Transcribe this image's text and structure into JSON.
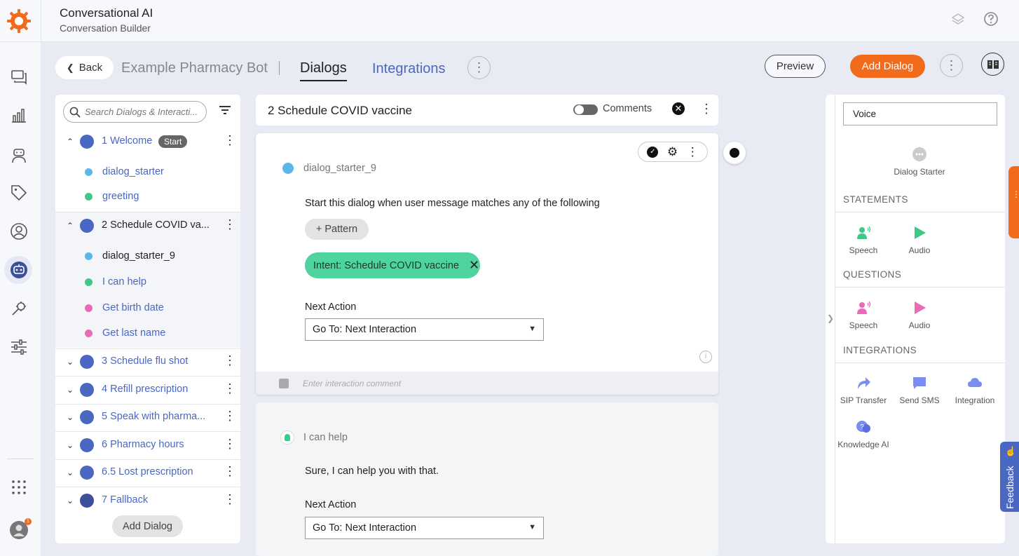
{
  "header": {
    "app_title": "Conversational AI",
    "app_subtitle": "Conversation Builder",
    "icons": [
      "logo-icon",
      "layers-icon",
      "help-icon"
    ]
  },
  "rail": {
    "icons": [
      "messages-icon",
      "analytics-icon",
      "agent-icon",
      "tag-icon",
      "user-icon",
      "bot-icon",
      "automation-icon",
      "settings-sliders-icon",
      "apps-grid-icon",
      "profile-avatar-icon"
    ],
    "active": "bot-icon",
    "notification_badge": "1"
  },
  "page_header": {
    "back_label": "Back",
    "bot_name": "Example Pharmacy Bot",
    "tabs": [
      {
        "label": "Dialogs",
        "active": true
      },
      {
        "label": "Integrations",
        "active": false
      }
    ],
    "preview_label": "Preview",
    "add_dialog_label": "Add Dialog"
  },
  "dialog_list": {
    "search_placeholder": "Search Dialogs & Interacti...",
    "start_badge": "Start",
    "dialogs": [
      {
        "label": "1 Welcome",
        "expanded": true
      },
      {
        "label": "2 Schedule COVID va...",
        "expanded": true,
        "selected": true
      },
      {
        "label": "3 Schedule flu shot",
        "expanded": false
      },
      {
        "label": "4 Refill prescription",
        "expanded": false
      },
      {
        "label": "5 Speak with pharma...",
        "expanded": false
      },
      {
        "label": "6 Pharmacy hours",
        "expanded": false
      },
      {
        "label": "6.5 Lost prescription",
        "expanded": false
      },
      {
        "label": "7 Fallback",
        "expanded": false
      }
    ],
    "welcome_children": [
      {
        "label": "dialog_starter",
        "kind": "starter"
      },
      {
        "label": "greeting",
        "kind": "statement"
      }
    ],
    "covid_children": [
      {
        "label": "dialog_starter_9",
        "kind": "starter",
        "selected": true
      },
      {
        "label": "I can help",
        "kind": "statement"
      },
      {
        "label": "Get birth date",
        "kind": "question"
      },
      {
        "label": "Get last name",
        "kind": "question"
      }
    ],
    "add_dialog_label": "Add Dialog"
  },
  "editor": {
    "title": "2 Schedule COVID vaccine",
    "comments_label": "Comments",
    "card1": {
      "name": "dialog_starter_9",
      "instruction": "Start this dialog when user message matches any of the following",
      "pattern_button": "+ Pattern",
      "intent_chip": "Intent:  Schedule COVID vaccine",
      "next_action_label": "Next Action",
      "next_action_value": "Go To:   Next Interaction",
      "comment_placeholder": "Enter interaction comment"
    },
    "card2": {
      "name": "I can help",
      "text": "Sure, I can help you with that.",
      "next_action_label": "Next Action",
      "next_action_value": "Go To:   Next Interaction"
    }
  },
  "right_panel": {
    "channel": "Voice",
    "dialog_starter_label": "Dialog Starter",
    "statements_title": "STATEMENTS",
    "statements": [
      "Speech",
      "Audio"
    ],
    "questions_title": "QUESTIONS",
    "questions": [
      "Speech",
      "Audio"
    ],
    "integrations_title": "INTEGRATIONS",
    "integrations": [
      "SIP Transfer",
      "Send SMS",
      "Integration",
      "Knowledge AI"
    ]
  },
  "feedback_label": "Feedback",
  "colors": {
    "brand_orange": "#f26b1d",
    "accent_blue": "#4a67c2",
    "intent_green": "#4fd4a0",
    "statement_green": "#3ec98b",
    "question_pink": "#e96bb6",
    "integration_purple": "#7a8ef2"
  }
}
